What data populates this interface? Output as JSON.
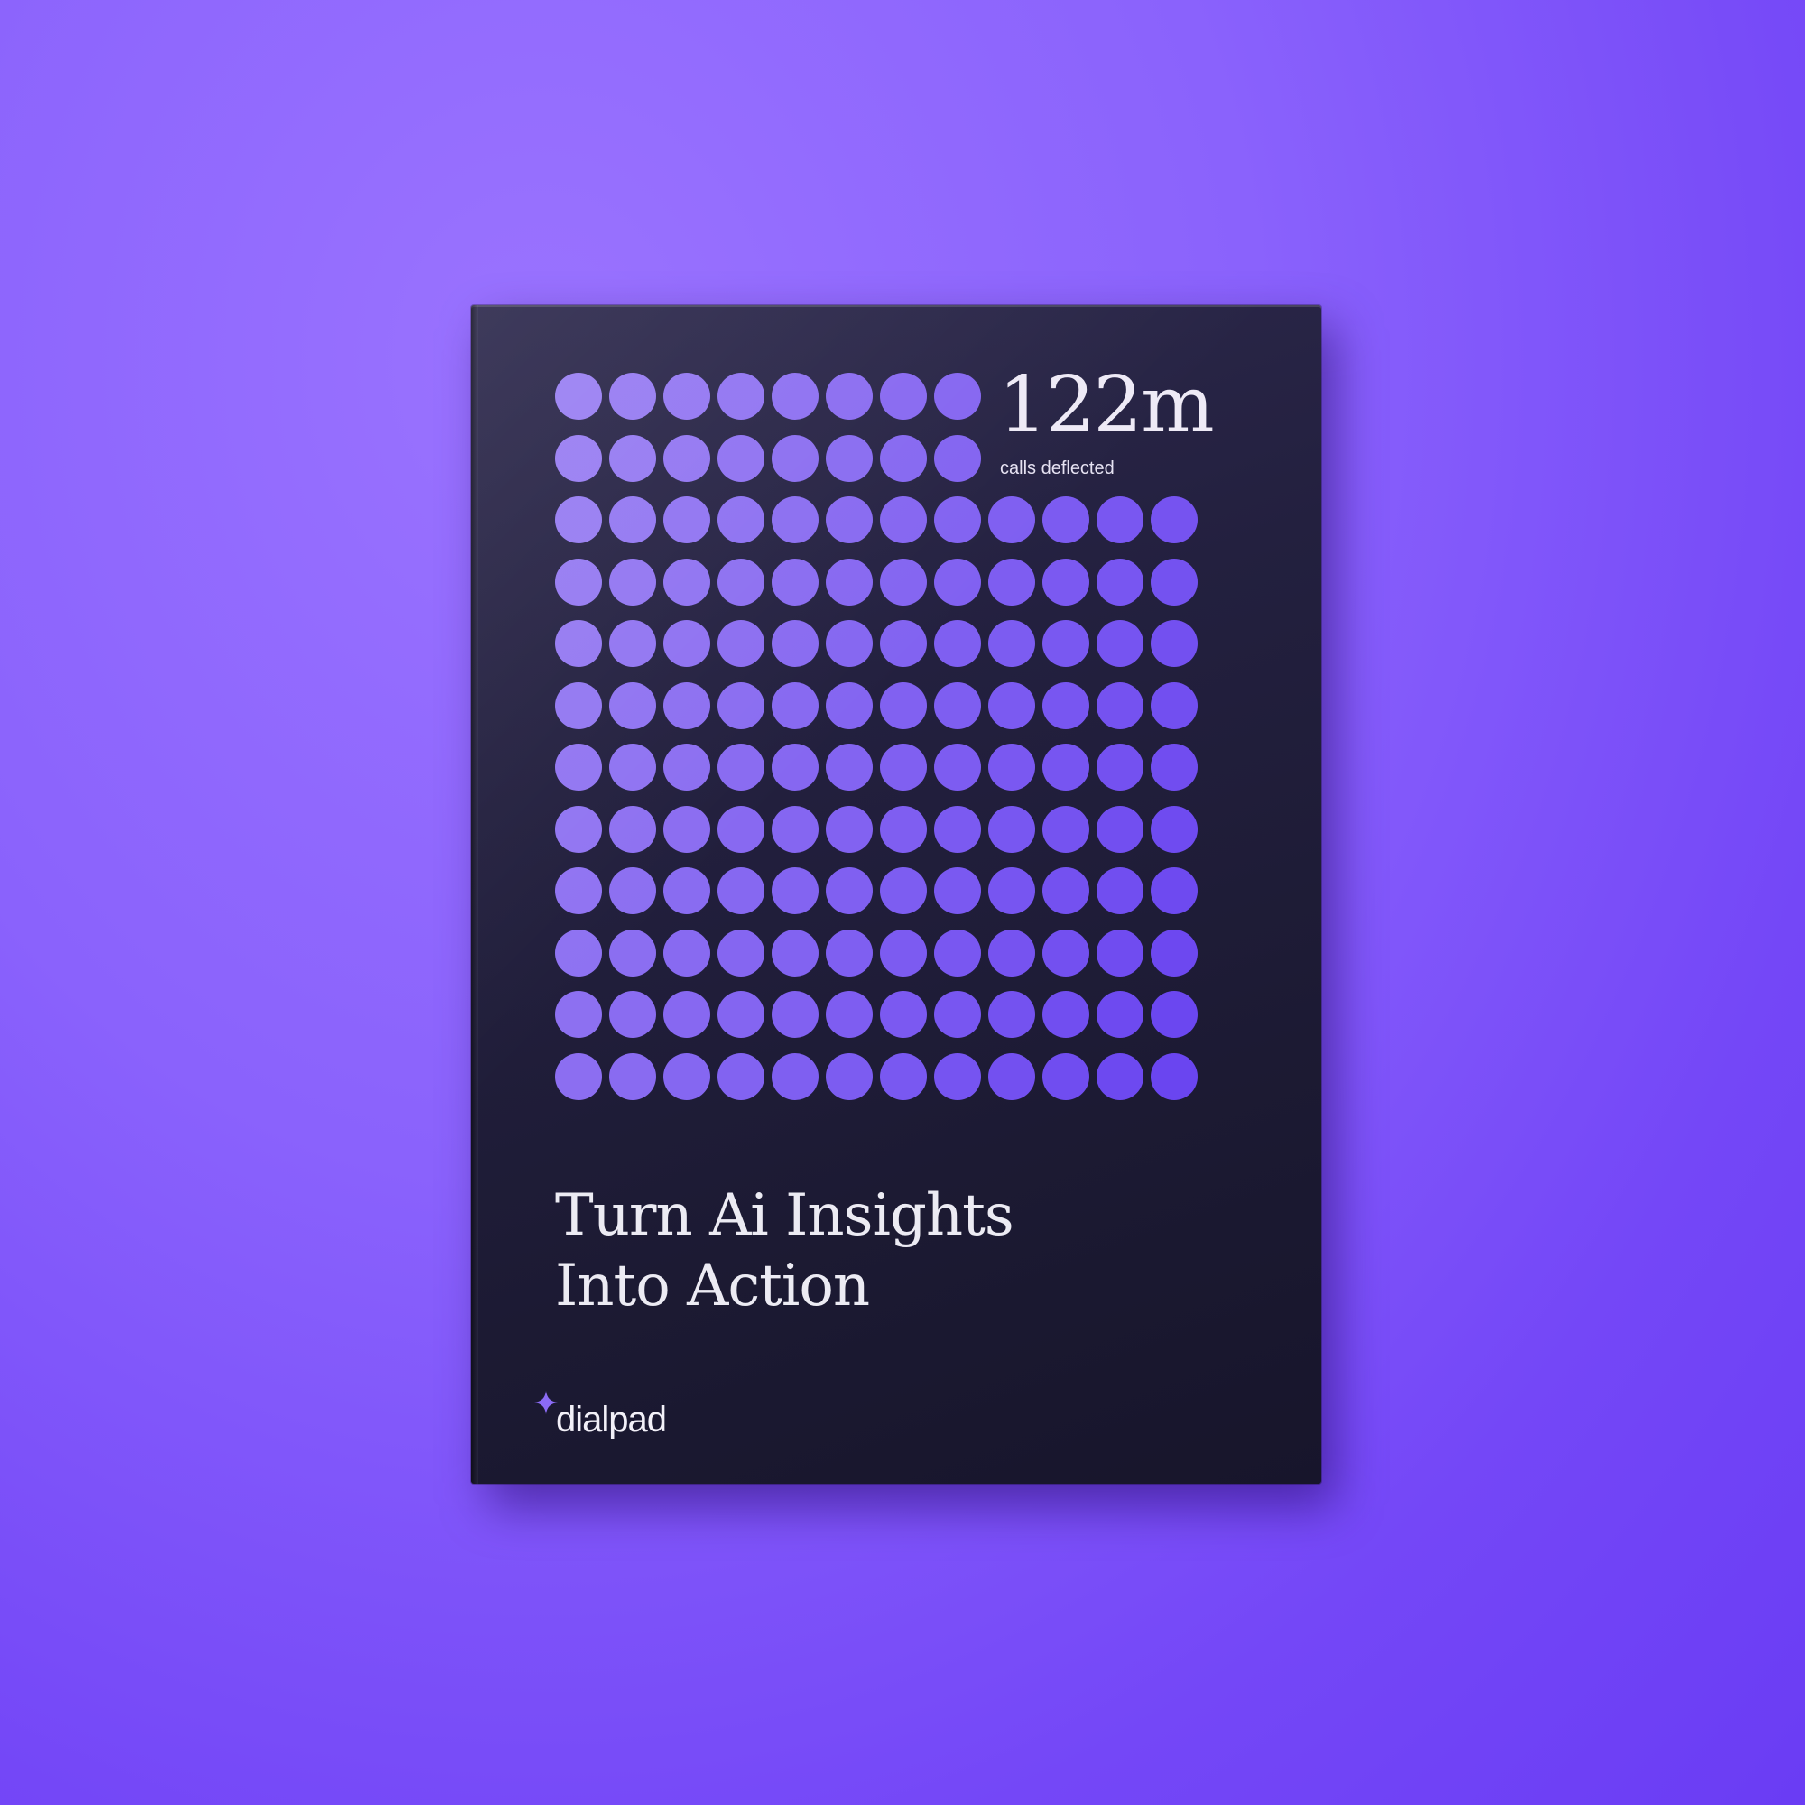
{
  "cover": {
    "stat_value": "122m",
    "stat_label": "calls deflected",
    "title_lines": [
      "Turn Ai Insights",
      "Into Action"
    ],
    "brand": "dialpad",
    "brand_icon": "sparkle-icon"
  },
  "dot_grid": {
    "rows": 12,
    "cols": 12,
    "row_lengths": [
      8,
      8,
      12,
      12,
      12,
      12,
      12,
      12,
      12,
      12,
      12,
      12
    ],
    "color_light": "#9a80f2",
    "color_dark": "#6a45f0"
  },
  "colors": {
    "background": "#8a62fc",
    "cover": "#1f1c38",
    "text": "#eeeaf6",
    "accent": "#8b6bf5"
  }
}
